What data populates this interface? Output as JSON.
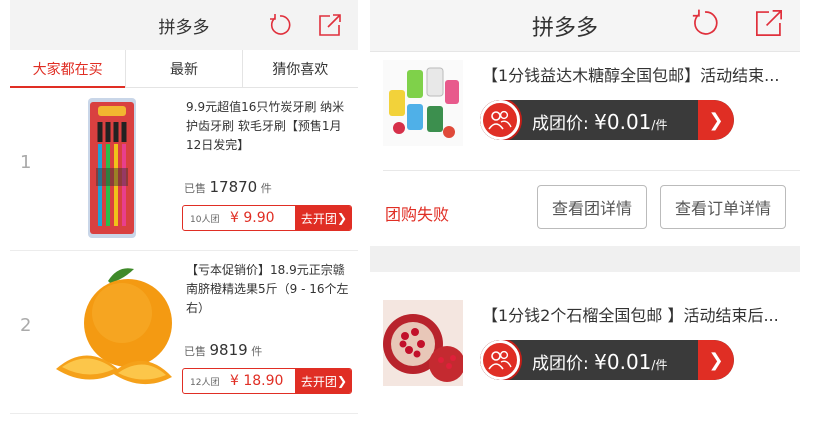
{
  "left": {
    "header": {
      "title": "拼多多"
    },
    "tabs": [
      {
        "label": "大家都在买",
        "active": true
      },
      {
        "label": "最新",
        "active": false
      },
      {
        "label": "猜你喜欢",
        "active": false
      }
    ],
    "products": [
      {
        "rank": "1",
        "name": "9.9元超值16只竹炭牙刷 纳米护齿牙刷 软毛牙刷【预售1月12日发完】",
        "sold_prefix": "已售",
        "sold_count": "17870",
        "sold_suffix": "件",
        "group_size": "10人团",
        "price": "¥ 9.90",
        "cta": "去开团",
        "image": "toothbrush-pack"
      },
      {
        "rank": "2",
        "name": "【亏本促销价】18.9元正宗赣南脐橙精选果5斤（9 - 16个左右）",
        "sold_prefix": "已售",
        "sold_count": "9819",
        "sold_suffix": "件",
        "group_size": "12人团",
        "price": "¥ 18.90",
        "cta": "去开团",
        "image": "navel-orange"
      }
    ]
  },
  "right": {
    "header": {
      "title": "拼多多"
    },
    "orders": [
      {
        "title": "【1分钱益达木糖醇全国包邮】活动结束...",
        "price_label": "成团价:",
        "price": "¥0.01",
        "unit": "/件",
        "image": "xylitol-gum-bottles"
      },
      {
        "title": "【1分钱2个石榴全国包邮 】活动结束后...",
        "price_label": "成团价:",
        "price": "¥0.01",
        "unit": "/件",
        "image": "pomegranate"
      }
    ],
    "status": {
      "fail_label": "团购失败",
      "view_group_label": "查看团详情",
      "view_order_label": "查看订单详情"
    }
  },
  "colors": {
    "accent": "#e02e24",
    "pill": "#3a3a3a",
    "header_bg": "#f3f3f3"
  },
  "icons": [
    "refresh-icon",
    "share-icon",
    "group-users-icon",
    "chevron-right-icon"
  ]
}
